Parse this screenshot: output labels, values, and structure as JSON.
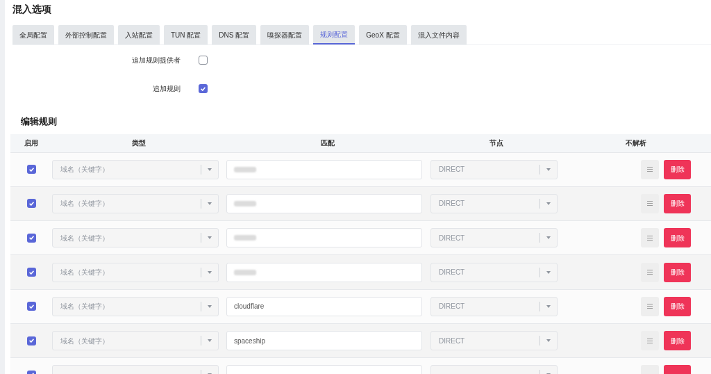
{
  "title": "混入选项",
  "tabs": [
    {
      "label": "全局配置",
      "selected": false
    },
    {
      "label": "外部控制配置",
      "selected": false
    },
    {
      "label": "入站配置",
      "selected": false
    },
    {
      "label": "TUN 配置",
      "selected": false
    },
    {
      "label": "DNS 配置",
      "selected": false
    },
    {
      "label": "嗅探器配置",
      "selected": false
    },
    {
      "label": "规则配置",
      "selected": true
    },
    {
      "label": "GeoX 配置",
      "selected": false
    },
    {
      "label": "混入文件内容",
      "selected": false
    }
  ],
  "options": [
    {
      "label": "追加规则提供者",
      "checked": false
    },
    {
      "label": "追加规则",
      "checked": true
    }
  ],
  "section_title": "编辑规则",
  "table": {
    "columns": [
      "启用",
      "类型",
      "匹配",
      "节点",
      "不解析"
    ],
    "rows": [
      {
        "enabled": true,
        "type": "域名（关键字）",
        "redacted": true,
        "node": "DIRECT",
        "delete": "删除"
      },
      {
        "enabled": true,
        "type": "域名（关键字）",
        "redacted": true,
        "node": "DIRECT",
        "delete": "删除"
      },
      {
        "enabled": true,
        "type": "域名（关键字）",
        "redacted": true,
        "node": "DIRECT",
        "delete": "删除"
      },
      {
        "enabled": true,
        "type": "域名（关键字）",
        "redacted": true,
        "node": "DIRECT",
        "delete": "删除"
      },
      {
        "enabled": true,
        "type": "域名（关键字）",
        "match": "cloudflare",
        "redacted": false,
        "node": "DIRECT",
        "delete": "删除"
      },
      {
        "enabled": true,
        "type": "域名（关键字）",
        "match": "spaceship",
        "redacted": false,
        "node": "DIRECT",
        "delete": "删除"
      },
      {
        "enabled": true,
        "redacted": false
      }
    ]
  }
}
